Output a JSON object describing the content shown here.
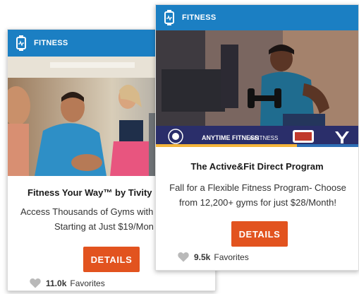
{
  "colors": {
    "header_blue": "#1b7fc3",
    "details_orange": "#e2531f",
    "heart_gray": "#b9b9b9",
    "logo_band": "#2a2e6a"
  },
  "cards": [
    {
      "category": "FITNESS",
      "category_icon": "fitness-watch-icon",
      "title": "Fitness Your Way™ by Tivity",
      "description_lines": [
        "Access Thousands of Gyms with",
        "Starting at Just $19/Mon"
      ],
      "button_label": "DETAILS",
      "favorites_count": "11.0k",
      "favorites_label": "Favorites"
    },
    {
      "category": "FITNESS",
      "category_icon": "fitness-watch-icon",
      "title": "The Active&Fit Direct Program",
      "description_lines": [
        "Fall for a Flexible Fitness Program- Choose",
        "from 12,200+ gyms for just $28/Month!"
      ],
      "button_label": "DETAILS",
      "favorites_count": "9.5k",
      "favorites_label": "Favorites",
      "gym_logos": [
        "ANYTIME FITNESS",
        "LA FITNESS"
      ]
    }
  ]
}
